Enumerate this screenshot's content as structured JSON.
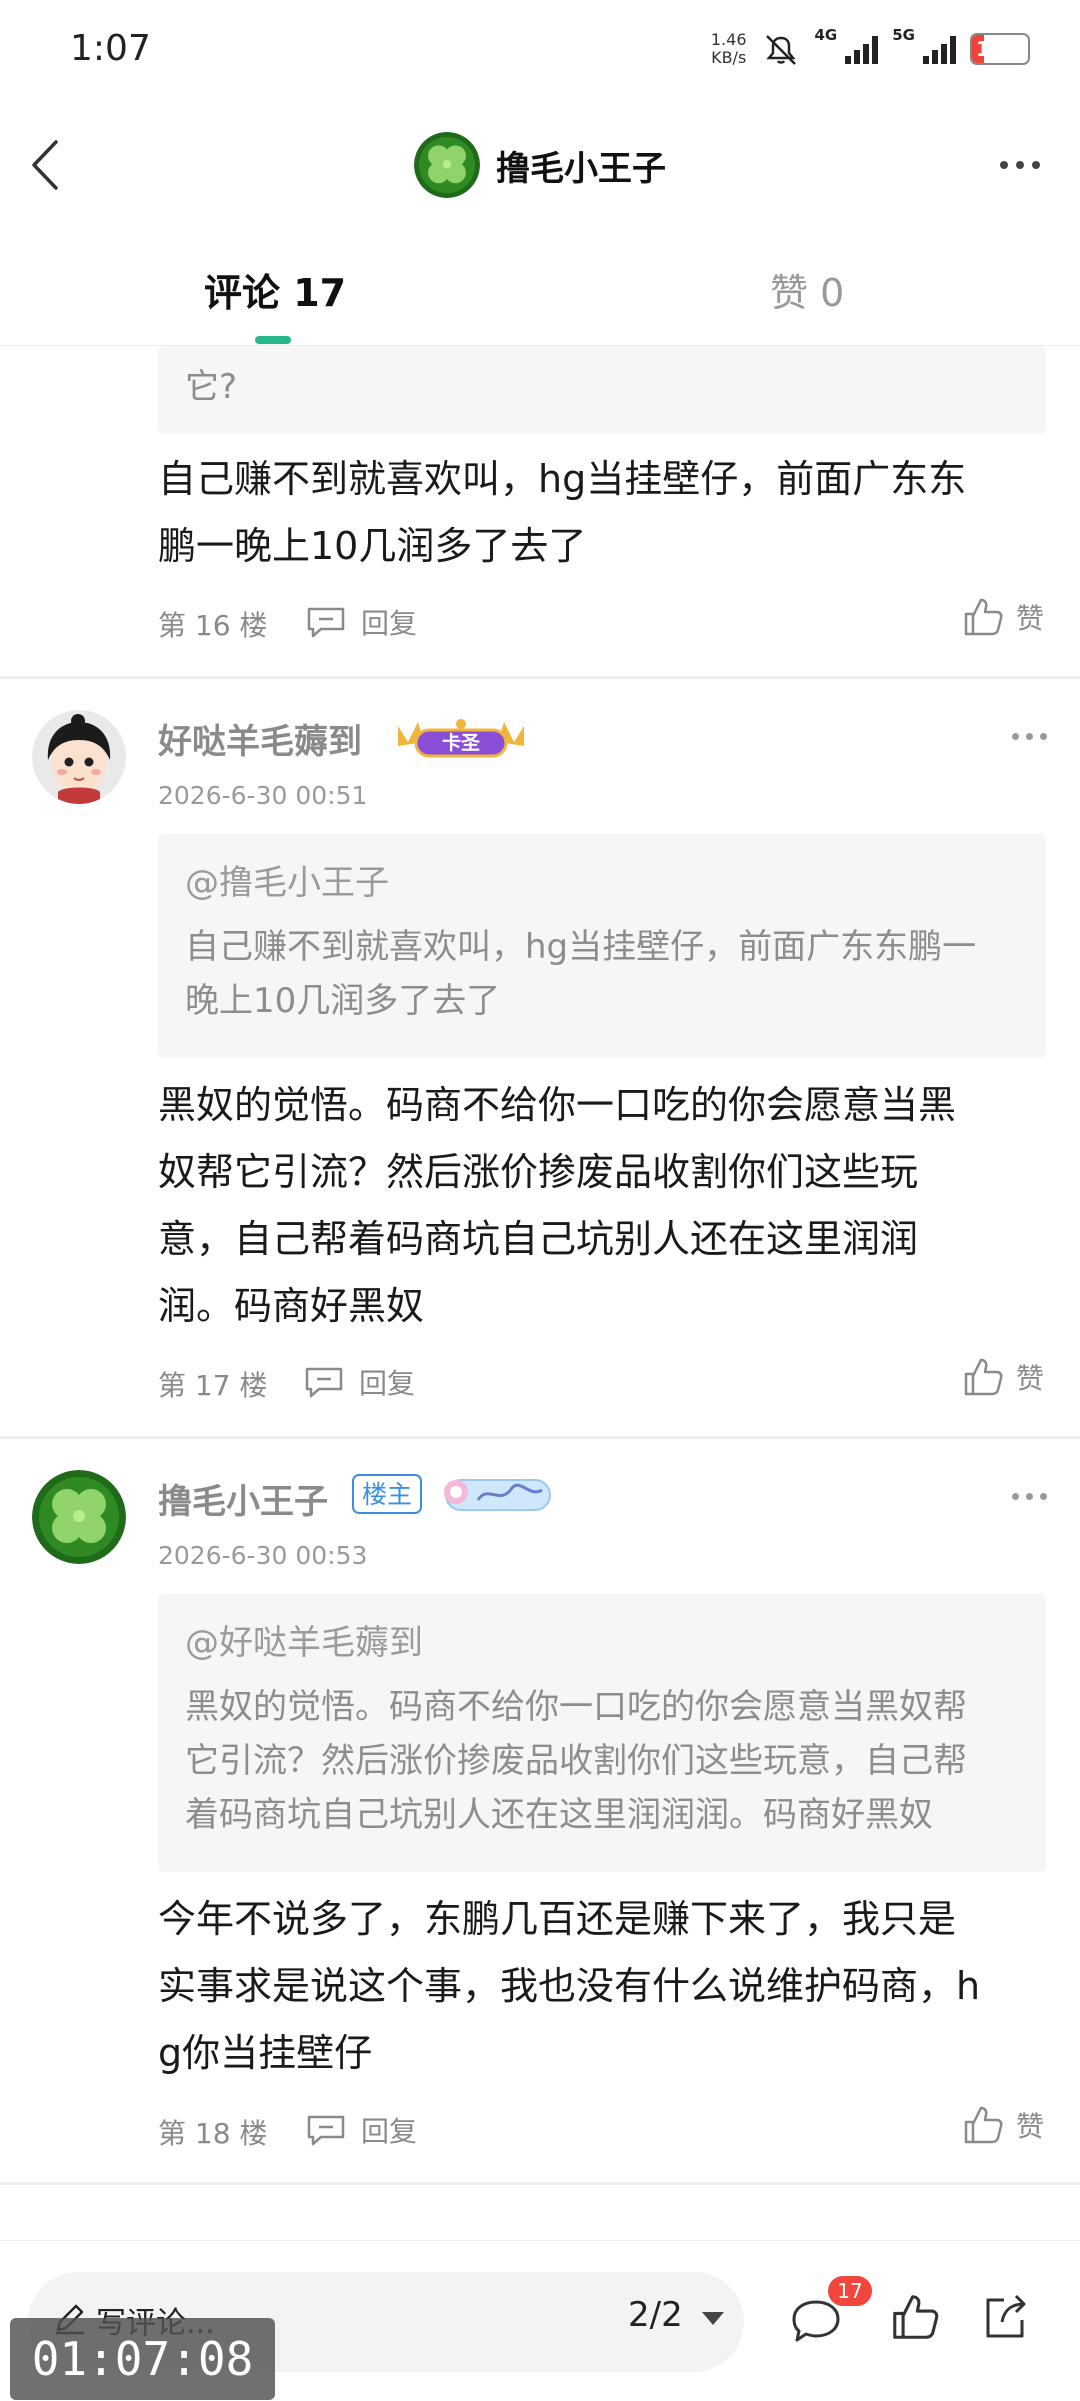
{
  "status_bar": {
    "time": "1:07",
    "net_speed_value": "1.46",
    "net_speed_unit": "KB/s",
    "signal_1_label": "4G",
    "signal_2_label": "5G",
    "battery_level": "19",
    "battery_color": "#f2403a"
  },
  "header": {
    "title": "撸毛小王子",
    "back_icon": "chevron-left-icon",
    "more_icon": "more-horizontal-icon"
  },
  "tabs": {
    "comments_label": "评论 17",
    "likes_label": "赞 0",
    "active_color": "#25b88a"
  },
  "floor16": {
    "quote_tail": "它?",
    "body_line1": "自己赚不到就喜欢叫，hg当挂壁仔，前面广东东",
    "body_line2": "鹏一晚上10几润多了去了",
    "floor_label": "第 16 楼",
    "reply_label": "回复",
    "like_label": "赞"
  },
  "floor17": {
    "username": "好哒羊毛薅到",
    "badge_label": "卡圣",
    "date": "2026-6-30 00:51",
    "quote_name": "@撸毛小王子",
    "quote_line1": "自己赚不到就喜欢叫，hg当挂壁仔，前面广东东鹏一",
    "quote_line2": "晚上10几润多了去了",
    "body_line1": "黑奴的觉悟。码商不给你一口吃的你会愿意当黑",
    "body_line2": "奴帮它引流？然后涨价掺废品收割你们这些玩",
    "body_line3": "意，自己帮着码商坑自己坑别人还在这里润润",
    "body_line4": "润。码商好黑奴",
    "floor_label": "第 17 楼",
    "reply_label": "回复",
    "like_label": "赞"
  },
  "floor18": {
    "username": "撸毛小王子",
    "host_badge": "楼主",
    "date": "2026-6-30 00:53",
    "quote_name": "@好哒羊毛薅到",
    "quote_line1": "黑奴的觉悟。码商不给你一口吃的你会愿意当黑奴帮",
    "quote_line2": "它引流？然后涨价掺废品收割你们这些玩意，自己帮",
    "quote_line3": "着码商坑自己坑别人还在这里润润润。码商好黑奴",
    "body_line1": "今年不说多了，东鹏几百还是赚下来了，我只是",
    "body_line2": "实事求是说这个事，我也没有什么说维护码商，h",
    "body_line3": "g你当挂壁仔",
    "floor_label": "第 18 楼",
    "reply_label": "回复",
    "like_label": "赞"
  },
  "bottom_bar": {
    "write_label": "写评论...",
    "pager": "2/2",
    "comment_count": "17",
    "icons": [
      "pencil-icon",
      "comment-icon",
      "thumbs-up-icon",
      "share-icon"
    ]
  },
  "overlay": {
    "timer": "01:07:08"
  }
}
